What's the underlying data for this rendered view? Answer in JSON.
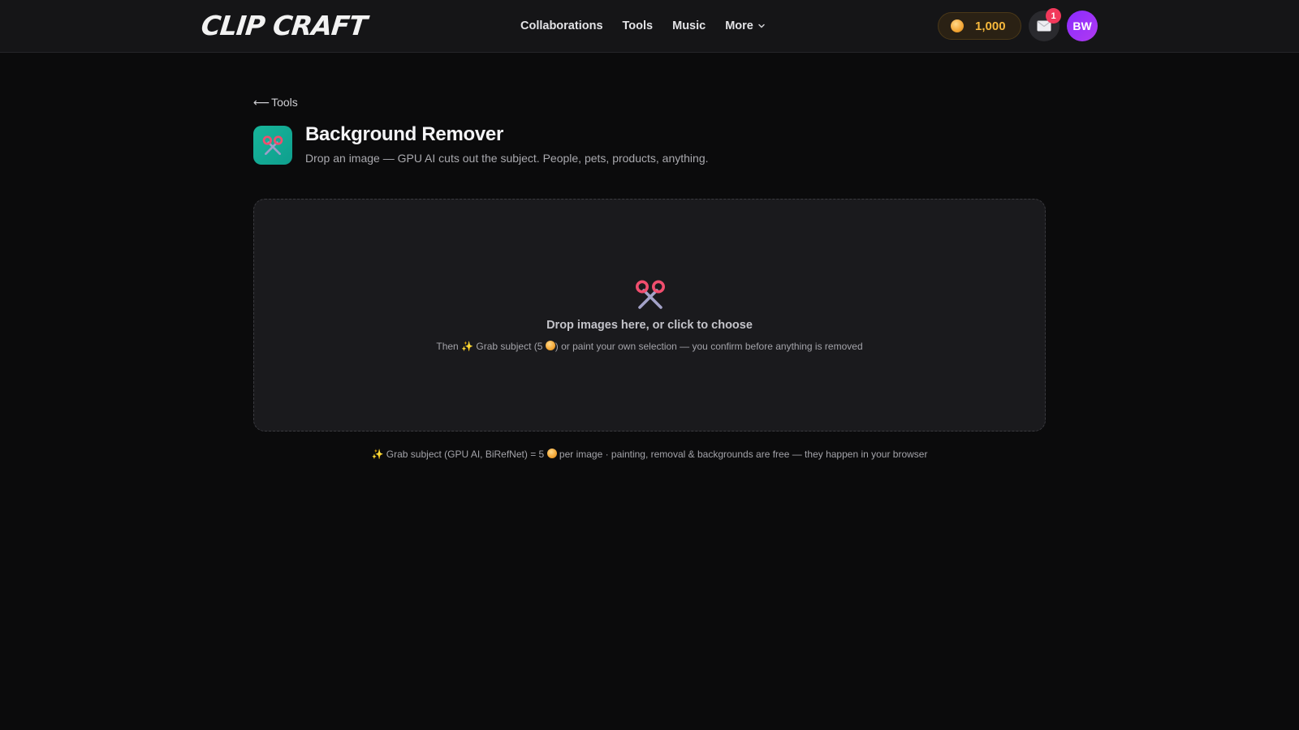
{
  "header": {
    "logo_text": "Clip Craft",
    "nav": [
      {
        "label": "Collaborations"
      },
      {
        "label": "Tools"
      },
      {
        "label": "Music"
      },
      {
        "label": "More"
      }
    ],
    "coins": "1,000",
    "notification_count": "1",
    "avatar_initials": "BW"
  },
  "page": {
    "back_label": "Tools",
    "back_arrow": "⟵",
    "title": "Background Remover",
    "subtitle": "Drop an image — GPU AI cuts out the subject. People, pets, products, anything."
  },
  "dropzone": {
    "title": "Drop images here, or click to choose",
    "sub_prefix": "Then",
    "sparkle": "✨",
    "sub_part1": "Grab subject (5",
    "sub_part2": ") or paint your own selection — you confirm before anything is removed"
  },
  "footnote": {
    "sparkle": "✨",
    "part1": "Grab subject (GPU AI, BiRefNet) = 5",
    "part2": "per image · painting, removal & backgrounds are free — they happen in your browser"
  },
  "icons": {
    "logo": "clip-craft-logo",
    "coin": "coin-icon",
    "notification": "envelope-icon",
    "tool": "scissors-icon"
  },
  "colors": {
    "background": "#0b0b0c",
    "topbar": "#151517",
    "accent_coin": "#f6b83c",
    "tool_icon_bg": "#17b59a",
    "badge": "#f2395b",
    "avatar": "#8a2bff"
  }
}
